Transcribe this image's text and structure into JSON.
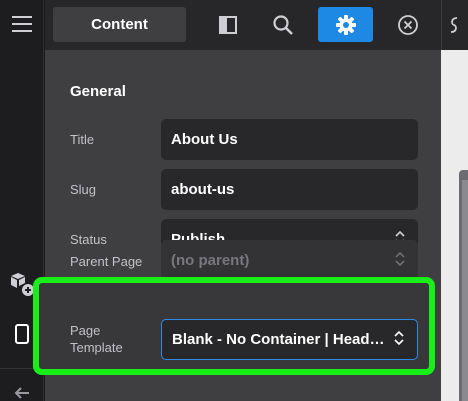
{
  "rail": {
    "icons": [
      "hamburger-icon",
      "add-element-icon",
      "mobile-icon",
      "back-arrow-icon"
    ]
  },
  "tabs": {
    "content_label": "Content",
    "icons": [
      "sidebar-toggle-icon",
      "search-icon",
      "gear-icon",
      "close-icon"
    ]
  },
  "general": {
    "title": "General",
    "fields": {
      "title": {
        "label": "Title",
        "value": "About Us"
      },
      "slug": {
        "label": "Slug",
        "value": "about-us"
      },
      "status": {
        "label": "Status",
        "value": "Publish"
      },
      "parent": {
        "label": "Parent Page",
        "value": "(no parent)"
      },
      "template": {
        "label_line1": "Page",
        "label_line2": "Template",
        "value": "Blank - No Container | Head…"
      }
    }
  },
  "colors": {
    "accent": "#1e88e5",
    "highlight": "#18ef18",
    "panel_bg": "#3f3f42",
    "field_bg": "#28282a"
  }
}
